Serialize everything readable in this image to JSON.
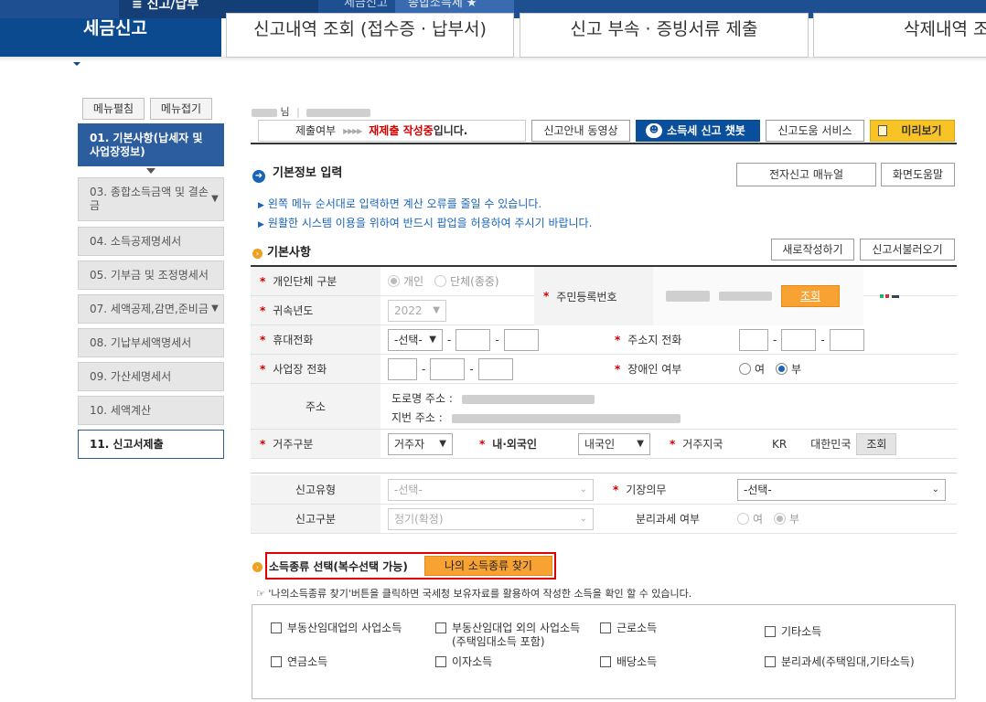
{
  "topnav": {
    "menu_label": "≡ 신고/납부",
    "crumb1": "세금신고",
    "crumb2": "종합소득세 ★",
    "main_tab": "세금신고",
    "sub_tabs": [
      "신고내역 조회 (접수증 · 납부서)",
      "신고 부속 · 증빙서류 제출",
      "삭제내역 조"
    ]
  },
  "sidebar": {
    "expand_label": "메뉴펼침",
    "collapse_label": "메뉴접기",
    "items": [
      {
        "label": "01. 기본사항(납세자 및 사업장정보)"
      },
      {
        "label": "03. 종합소득금액 및 결손금"
      },
      {
        "label": "04. 소득공제명세서"
      },
      {
        "label": "05. 기부금 및 조정명세서"
      },
      {
        "label": "07. 세액공제,감면,준비금"
      },
      {
        "label": "08. 기납부세액명세서"
      },
      {
        "label": "09. 가산세명세서"
      },
      {
        "label": "10. 세액계산"
      },
      {
        "label": "11. 신고서제출"
      }
    ]
  },
  "header": {
    "user_suffix": "님"
  },
  "status": {
    "prefix": "제출여부",
    "arrows": "▸▸▸▸",
    "state": "재제출 작성중",
    "suffix": "입니다."
  },
  "toolbar": {
    "video": "신고안내 동영상",
    "chatbot": "소득세 신고 챗봇",
    "help_service": "신고도움 서비스",
    "preview": "미리보기"
  },
  "section": {
    "title": "기본정보 입력",
    "manual_btn": "전자신고 매뉴얼",
    "screen_help_btn": "화면도움말",
    "note1": "왼쪽 메뉴 순서대로 입력하면 계산 오류를 줄일 수 있습니다.",
    "note2": "원활한 시스템 이용을 위하여 반드시 팝업을 허용하여 주시기 바랍니다."
  },
  "basic": {
    "title": "기본사항",
    "new_btn": "새로작성하기",
    "load_btn": "신고서불러오기",
    "indiv_group_label": "개인단체 구분",
    "indiv": "개인",
    "group": "단체(종중)",
    "year_label": "귀속년도",
    "year_value": "2022",
    "rrn_label": "주민등록번호",
    "lookup_btn": "조회",
    "mobile_label": "휴대전화",
    "mobile_select": "-선택-",
    "home_phone_label": "주소지 전화",
    "biz_phone_label": "사업장 전화",
    "disabled_label": "장애인 여부",
    "yes": "여",
    "no": "부",
    "address_label": "주소",
    "road_addr_label": "도로명 주소 :",
    "lot_addr_label": "지번 주소 :",
    "residence_label": "거주구분",
    "residence_value": "거주자",
    "nationality_label": "내·외국인",
    "nationality_value": "내국인",
    "region_label": "거주지국",
    "region_code": "KR",
    "region_name": "대한민국",
    "region_btn": "조회"
  },
  "report": {
    "type_label": "신고유형",
    "type_value": "-선택-",
    "bookkeeping_label": "기장의무",
    "bookkeeping_value": "-선택-",
    "category_label": "신고구분",
    "category_value": "정기(확정)",
    "separate_label": "분리과세 여부",
    "yes": "여",
    "no": "부"
  },
  "income": {
    "title": "소득종류 선택(복수선택 가능)",
    "find_btn": "나의 소득종류 찾기",
    "hint": "☞ '나의소득종류 찾기'버튼을 클릭하면 국세청 보유자료를 활용하여 작성한 소득을 확인 할 수 있습니다.",
    "types": [
      "부동산임대업의 사업소득",
      "부동산임대업 외의 사업소득",
      "(주택임대소득 포함)",
      "근로소득",
      "기타소득",
      "연금소득",
      "이자소득",
      "배당소득",
      "분리과세(주택임대,기타소득)"
    ]
  },
  "colors": {
    "nav": "#1d4f91",
    "main_tab": "#0b4a8f",
    "sidebar_active": "#2c5d9f",
    "highlight_red": "#e00000",
    "orange": "#f7a232"
  }
}
